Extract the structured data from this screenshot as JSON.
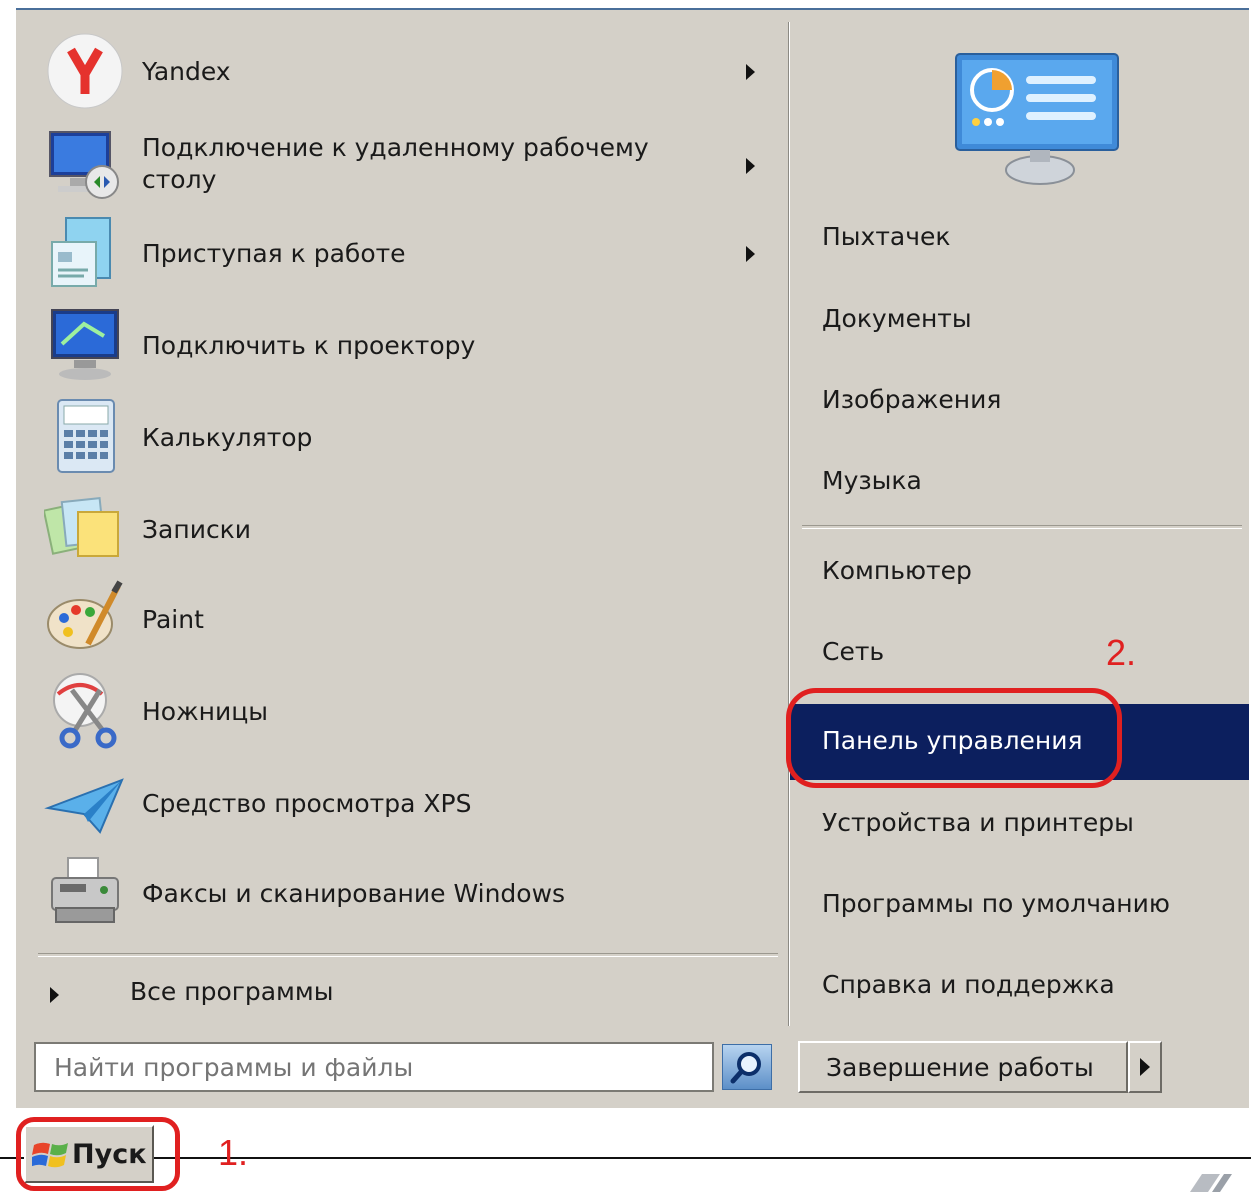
{
  "left_programs": [
    {
      "label": "Yandex",
      "icon": "yandex-icon",
      "has_submenu": true
    },
    {
      "label": "Подключение к удаленному рабочему столу",
      "icon": "remote-desktop-icon",
      "has_submenu": true
    },
    {
      "label": "Приступая к работе",
      "icon": "getting-started-icon",
      "has_submenu": true
    },
    {
      "label": "Подключить к проектору",
      "icon": "projector-icon",
      "has_submenu": false
    },
    {
      "label": "Калькулятор",
      "icon": "calculator-icon",
      "has_submenu": false
    },
    {
      "label": "Записки",
      "icon": "sticky-notes-icon",
      "has_submenu": false
    },
    {
      "label": "Paint",
      "icon": "paint-icon",
      "has_submenu": false
    },
    {
      "label": "Ножницы",
      "icon": "scissors-icon",
      "has_submenu": false
    },
    {
      "label": "Средство просмотра XPS",
      "icon": "xps-viewer-icon",
      "has_submenu": false
    },
    {
      "label": "Факсы и сканирование Windows",
      "icon": "fax-scan-icon",
      "has_submenu": false
    }
  ],
  "all_programs_label": "Все программы",
  "right_items": [
    {
      "label": "Пыхтачек",
      "active": false
    },
    {
      "label": "Документы",
      "active": false
    },
    {
      "label": "Изображения",
      "active": false
    },
    {
      "label": "Музыка",
      "active": false
    },
    {
      "label": "Компьютер",
      "active": false
    },
    {
      "label": "Сеть",
      "active": false
    },
    {
      "label": "Панель управления",
      "active": true
    },
    {
      "label": "Устройства и принтеры",
      "active": false
    },
    {
      "label": "Программы по умолчанию",
      "active": false
    },
    {
      "label": "Справка и поддержка",
      "active": false
    }
  ],
  "search": {
    "placeholder": "Найти программы и файлы"
  },
  "shutdown_label": "Завершение работы",
  "start_label": "Пуск",
  "annotations": {
    "step1": "1.",
    "step2": "2."
  },
  "colors": {
    "menu_bg": "#d4d0c8",
    "highlight": "#0c1f5e",
    "annotation": "#e02020"
  }
}
